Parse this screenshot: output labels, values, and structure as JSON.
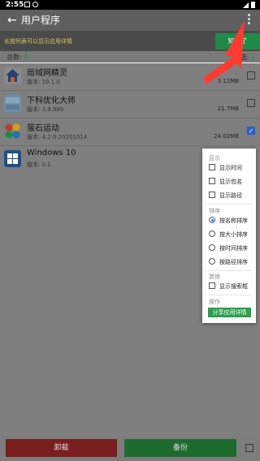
{
  "status_bar": {
    "time": "2:55"
  },
  "app_bar": {
    "back_glyph": "←",
    "title": "用户程序",
    "overflow_icon": "vertical-ellipsis"
  },
  "hint": {
    "text": "长按列表可以显示应用详情",
    "button": "知道了"
  },
  "summary": {
    "total_label": "总数:",
    "total": "4",
    "selected_label": "已选:",
    "selected": "2"
  },
  "apps": [
    {
      "name": "局域网精灵",
      "version": "版本: 10.1.0",
      "size": "3.11MB",
      "checked": false,
      "icon": "lan-house-icon"
    },
    {
      "name": "下科优化大师",
      "version": "版本: 3.9.989",
      "size": "21.7MB",
      "checked": false,
      "icon": "optimizer-icon"
    },
    {
      "name": "萤石运动",
      "version": "版本: 4.2.0.20201014",
      "size": "24.02MB",
      "checked": true,
      "icon": "sport-pinwheel-icon"
    },
    {
      "name": "Windows 10",
      "version": "版本: 0.1",
      "size": "",
      "checked": false,
      "icon": "windows-icon"
    }
  ],
  "menu": {
    "display_header": "显示",
    "display_items": [
      "显示时间",
      "显示包名",
      "显示路径"
    ],
    "sort_header": "排序",
    "sort_items": [
      "按名称排序",
      "按大小排序",
      "按时间排序",
      "按路径排序"
    ],
    "sort_selected": 0,
    "other_header": "其他",
    "other_items": [
      "显示搜索框"
    ],
    "action_header": "操作",
    "action_button": "分享应用详情"
  },
  "bottom": {
    "uninstall": "卸载",
    "backup": "备份"
  },
  "colors": {
    "accent_green": "#2aa04a",
    "arrow_red": "#ff3b2f",
    "checkbox_blue": "#2c60c8"
  }
}
